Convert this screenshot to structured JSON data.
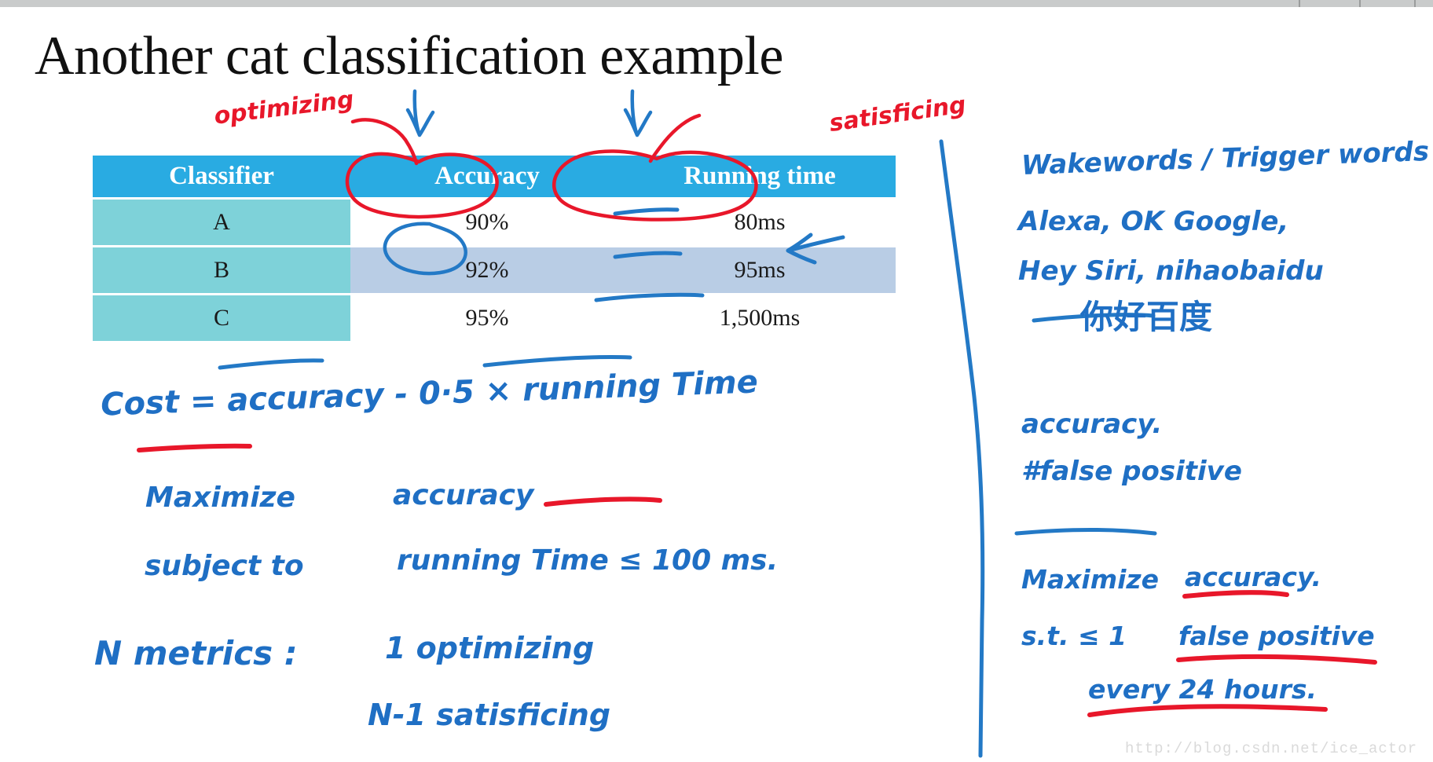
{
  "top_strip": {
    "dividers_x": [
      1653,
      1730,
      1800
    ],
    "color": "#c9cbcb"
  },
  "title": "Another cat classification example",
  "colors": {
    "header_blue": "#29abe2",
    "first_col_teal": "#7ed2d9",
    "highlight_row": "#b9cde5",
    "ink_blue": "#1f6fc4",
    "ink_red": "#e8172a",
    "watermark_grey": "#dadada"
  },
  "table": {
    "columns": [
      "Classifier",
      "Accuracy",
      "Running time"
    ],
    "rows": [
      {
        "classifier": "A",
        "accuracy": "90%",
        "running_time": "80ms",
        "highlighted": false
      },
      {
        "classifier": "B",
        "accuracy": "92%",
        "running_time": "95ms",
        "highlighted": true
      },
      {
        "classifier": "C",
        "accuracy": "95%",
        "running_time": "1,500ms",
        "highlighted": false
      }
    ]
  },
  "annotations": {
    "optimizing_label": "optimizing",
    "satisficing_label": "satisficing",
    "cost_equation": "Cost = accuracy  -  0·5 × running Time",
    "maximize": "Maximize",
    "maximize_target": "accuracy",
    "subject_to": "subject to",
    "constraint": "running Time  ≤ 100 ms.",
    "n_metrics": "N  metrics :",
    "one_optimizing": "1   optimizing",
    "n_minus_one_satisficing": "N-1   satisficing",
    "right": {
      "wakewords": "Wakewords / Trigger words",
      "examples_1": "Alexa,  OK  Google,",
      "examples_2": "Hey Siri,   nihaobaidu",
      "examples_cjk": "你好百度",
      "accuracy_note": "accuracy.",
      "false_positive_note": "#false     positive",
      "maximize": "Maximize",
      "maximize_target": "accuracy.",
      "subject_to": "s.t. ≤ 1",
      "constraint_a": "false  positive",
      "constraint_b": "every  24  hours."
    }
  },
  "watermark": "http://blog.csdn.net/ice_actor"
}
